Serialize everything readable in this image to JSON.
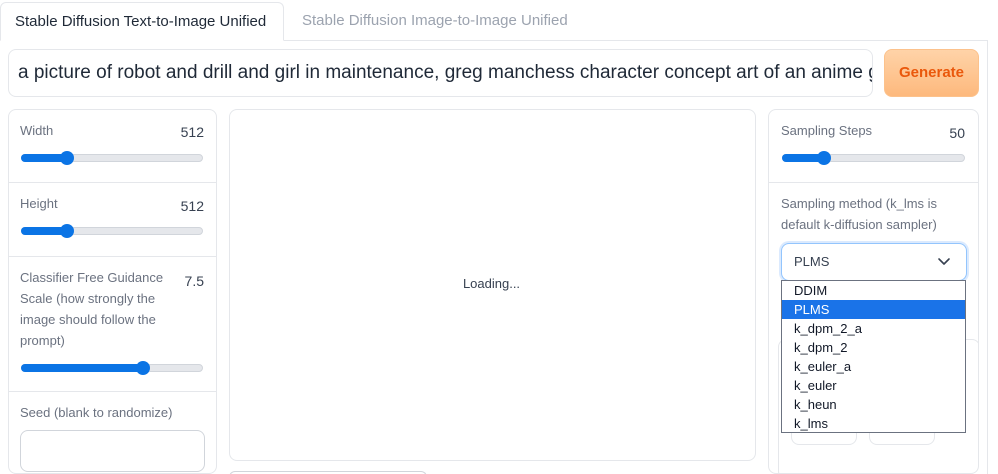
{
  "tabs": [
    {
      "label": "Stable Diffusion Text-to-Image Unified",
      "active": true
    },
    {
      "label": "Stable Diffusion Image-to-Image Unified",
      "active": false
    }
  ],
  "prompt": {
    "value": "a picture of robot and drill and girl in maintenance, greg manchess character concept art of an anime godd"
  },
  "generate_label": "Generate",
  "left_panel": {
    "width": {
      "label": "Width",
      "value": "512",
      "fraction": 0.25
    },
    "height": {
      "label": "Height",
      "value": "512",
      "fraction": 0.25
    },
    "cfg": {
      "label": "Classifier Free Guidance Scale (how strongly the image should follow the prompt)",
      "value": "7.5",
      "fraction": 0.66
    },
    "seed": {
      "label": "Seed (blank to randomize)",
      "value": ""
    }
  },
  "output": {
    "status": "Loading..."
  },
  "right_panel": {
    "steps": {
      "label": "Sampling Steps",
      "value": "50",
      "fraction": 0.22
    },
    "method": {
      "label": "Sampling method (k_lms is default k-diffusion sampler)",
      "selected": "PLMS",
      "options": [
        "DDIM",
        "PLMS",
        "k_dpm_2_a",
        "k_dpm_2",
        "k_euler_a",
        "k_euler",
        "k_heun",
        "k_lms"
      ]
    }
  },
  "colors": {
    "accent": "#0b74e5",
    "generate_text": "#ea580c",
    "selected_option": "#1a73e8"
  }
}
